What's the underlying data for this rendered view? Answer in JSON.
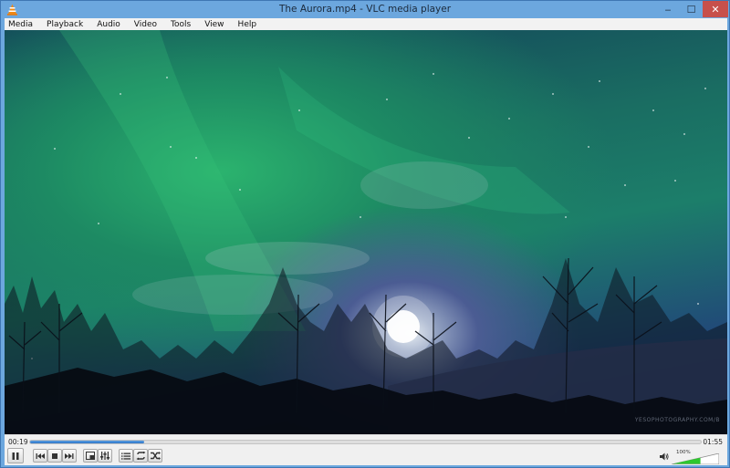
{
  "window": {
    "title": "The Aurora.mp4 - VLC media player",
    "controls": {
      "minimize": "‒",
      "maximize": "☐",
      "close": "✕"
    }
  },
  "menu": [
    "Media",
    "Playback",
    "Audio",
    "Video",
    "Tools",
    "View",
    "Help"
  ],
  "video": {
    "watermark": "YESOPHOTOGRAPHY.COM/B"
  },
  "playback": {
    "elapsed": "00:19",
    "total": "01:55",
    "progress": 0.17,
    "state": "playing",
    "volume_label": "100%",
    "volume": 1.0
  },
  "colors": {
    "accent": "#2c74c7",
    "volume": "#2ec72e",
    "close": "#c7504b"
  }
}
